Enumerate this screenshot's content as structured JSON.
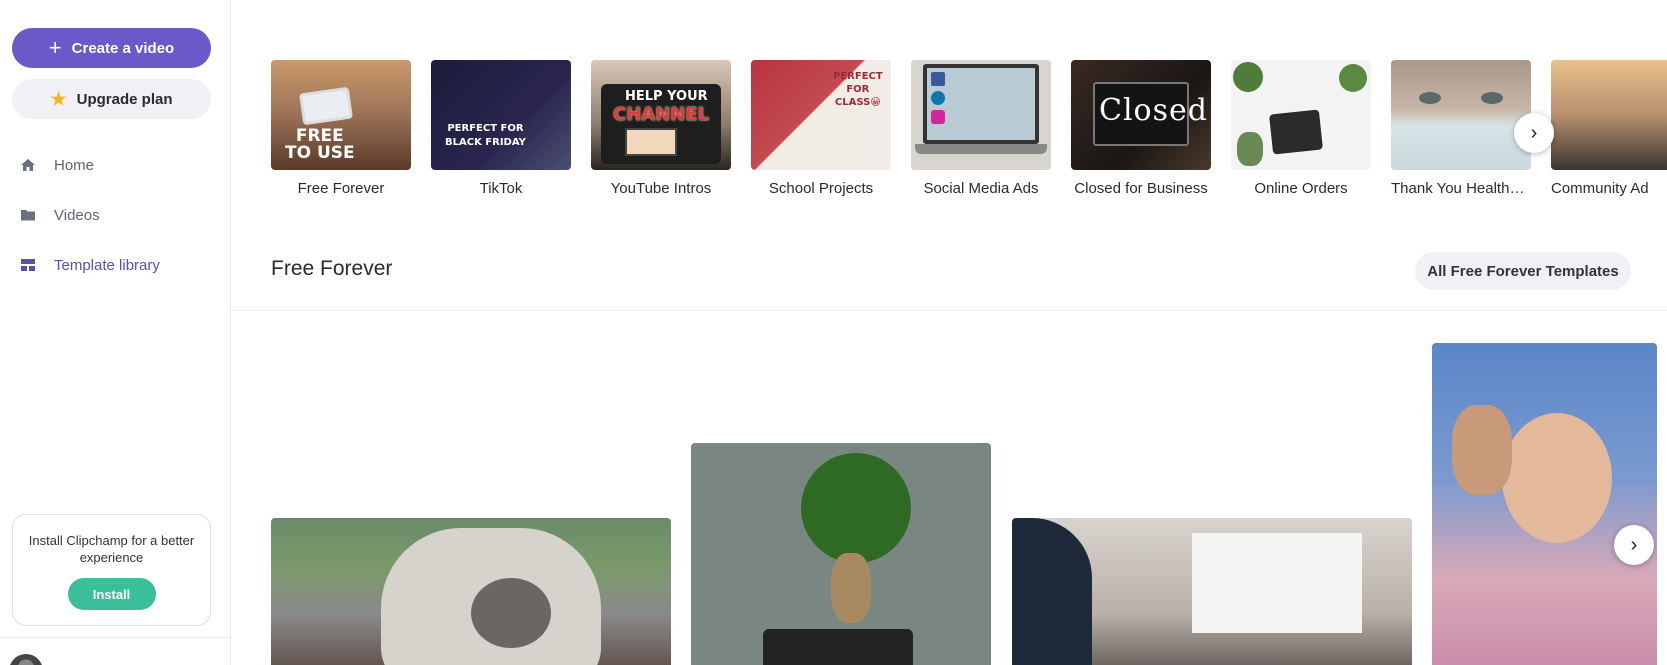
{
  "sidebar": {
    "create_label": "Create a video",
    "upgrade_label": "Upgrade plan",
    "nav": [
      {
        "label": "Home",
        "icon": "home-icon"
      },
      {
        "label": "Videos",
        "icon": "folder-icon"
      },
      {
        "label": "Template library",
        "icon": "template-library-icon"
      }
    ],
    "install_card": {
      "text": "Install Clipchamp for a better experience",
      "button": "Install"
    }
  },
  "categories": [
    {
      "label": "Free Forever",
      "thumb_text": "FREE\nTO USE"
    },
    {
      "label": "TikTok",
      "thumb_text": "PERFECT FOR\nBLACK FRIDAY"
    },
    {
      "label": "YouTube Intros",
      "thumb_text_1": "HELP YOUR",
      "thumb_text_2": "CHANNEL"
    },
    {
      "label": "School Projects",
      "thumb_text": "PERFECT\nFOR\nCLASS😀"
    },
    {
      "label": "Social Media Ads"
    },
    {
      "label": "Closed for Business",
      "thumb_text": "Closed"
    },
    {
      "label": "Online Orders"
    },
    {
      "label": "Thank You Healthc…"
    },
    {
      "label": "Community Ad"
    }
  ],
  "section": {
    "title": "Free Forever",
    "all_button": "All Free Forever Templates"
  },
  "colors": {
    "accent": "#6a59c9",
    "install": "#3bbf9a",
    "active_nav": "#5a4fb0"
  }
}
